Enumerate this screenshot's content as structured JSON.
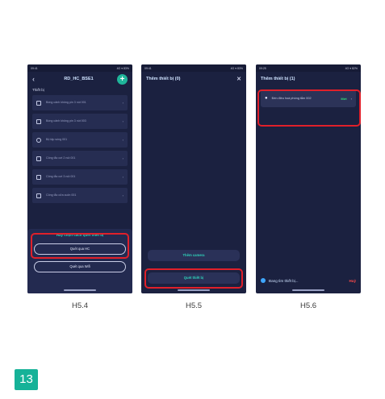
{
  "screen1": {
    "status_time": "09:41",
    "status_right": "4G ▾ 83%",
    "title": "RD_HC_BSE1",
    "section": "Thiết bị",
    "devices": [
      {
        "label": "Bóng cảnh không pin 3 nút 001",
        "icon": "square-icon"
      },
      {
        "label": "Bóng cảnh không pin 3 nút 003",
        "icon": "square-icon"
      },
      {
        "label": "Bộ tập sóng 001",
        "icon": "router-icon"
      },
      {
        "label": "Công tắc cơi 2 nút 001",
        "icon": "square-icon"
      },
      {
        "label": "Công tắc cơi 3 nút 001",
        "icon": "square-icon"
      },
      {
        "label": "Công tắc cửa cuốn 001",
        "icon": "curtain-icon"
      }
    ],
    "sheet_title": "Hãy chọn cách quét thiết bị",
    "scan_hc": "Quét qua HC",
    "scan_wifi": "Quét qua Wifi",
    "caption": "H5.4"
  },
  "screen2": {
    "status_time": "09:41",
    "status_right": "4G ▾ 83%",
    "title": "Thêm thiết bị (0)",
    "add_camera": "Thêm camera",
    "scan_device": "Quét thiết bị",
    "caption": "H5.5"
  },
  "screen3": {
    "status_time": "09:25",
    "status_right": "4G ▾ 82%",
    "title": "Thêm thiết bị (1)",
    "found_device": "Đèn điều hoà phòng tắm 002",
    "found_status": "Mới",
    "searching": "Đang tìm thiết bị...",
    "cancel": "Huỷ",
    "caption": "H5.6"
  },
  "page_number": "13",
  "colors": {
    "accent": "#1fb59a",
    "highlight": "#e0202a",
    "panel": "#1b2140"
  }
}
